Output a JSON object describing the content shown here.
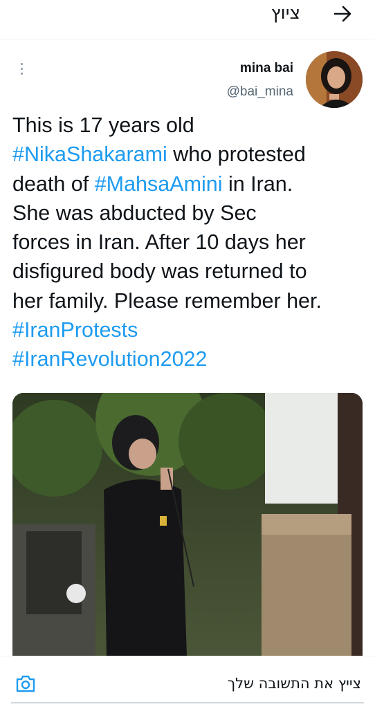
{
  "header": {
    "title": "ציוץ",
    "back_icon": "arrow-right-icon"
  },
  "tweet": {
    "author_name": "mina bai",
    "author_handle": "@bai_mina",
    "more_icon": "more-vertical-icon",
    "text_lines": [
      [
        {
          "t": "This is 17 years old",
          "h": false
        }
      ],
      [
        {
          "t": "#NikaShakarami",
          "h": true
        },
        {
          "t": " who protested",
          "h": false
        }
      ],
      [
        {
          "t": "death of ",
          "h": false
        },
        {
          "t": "#MahsaAmini",
          "h": true
        },
        {
          "t": " in Iran.",
          "h": false
        }
      ],
      [
        {
          "t": "She was abducted by Sec",
          "h": false
        }
      ],
      [
        {
          "t": "forces in Iran. After 10 days her",
          "h": false
        }
      ],
      [
        {
          "t": "disfigured body was returned to",
          "h": false
        }
      ],
      [
        {
          "t": "her family. Please remember her.",
          "h": false
        }
      ],
      [
        {
          "t": "#IranProtests",
          "h": true
        }
      ],
      [
        {
          "t": "#IranRevolution2022",
          "h": true
        }
      ]
    ]
  },
  "reply": {
    "placeholder": "צייץ את התשובה שלך",
    "camera_icon": "camera-icon"
  },
  "colors": {
    "hashtag": "#1d9bf0",
    "text": "#0f1419",
    "secondary": "#536471"
  }
}
